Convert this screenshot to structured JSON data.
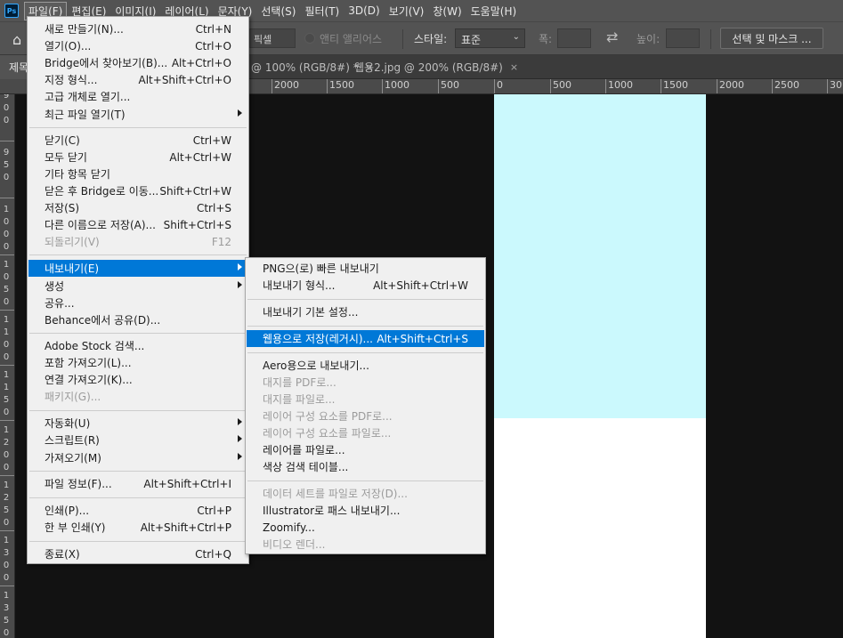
{
  "menubar": {
    "logo": "Ps",
    "items": [
      {
        "label": "파일(F)",
        "active": true
      },
      {
        "label": "편집(E)"
      },
      {
        "label": "이미지(I)"
      },
      {
        "label": "레이어(L)"
      },
      {
        "label": "문자(Y)"
      },
      {
        "label": "선택(S)"
      },
      {
        "label": "필터(T)"
      },
      {
        "label": "3D(D)"
      },
      {
        "label": "보기(V)"
      },
      {
        "label": "창(W)"
      },
      {
        "label": "도움말(H)"
      }
    ]
  },
  "options": {
    "feather_value": "픽셀",
    "antialias_label": "앤티 앨리어스",
    "style_label": "스타일:",
    "style_value": "표준",
    "width_label": "폭:",
    "height_label": "높이:",
    "select_mask_label": "선택 및 마스크 ..."
  },
  "tabs": [
    {
      "title": "제목"
    },
    {
      "title": "@ 100% (RGB/8#) *",
      "close": "×"
    },
    {
      "title": "웹용2.jpg @ 200% (RGB/8#)",
      "close": "×"
    }
  ],
  "ruler": {
    "horizontal": [
      "2000",
      "1500",
      "1000",
      "500",
      "0",
      "500",
      "1000",
      "1500",
      "2000",
      "2500",
      "30"
    ],
    "vertical": [
      "9",
      "0",
      "0",
      "9",
      "5",
      "0",
      "1",
      "0",
      "0",
      "0",
      "1",
      "0",
      "5",
      "0",
      "1",
      "1",
      "0",
      "0",
      "1",
      "1",
      "5",
      "0",
      "1",
      "2",
      "0",
      "0",
      "1",
      "2",
      "5",
      "0",
      "1",
      "3",
      "0",
      "0",
      "1",
      "3",
      "5",
      "0"
    ]
  },
  "file_menu": {
    "items": [
      {
        "label": "새로 만들기(N)...",
        "shortcut": "Ctrl+N"
      },
      {
        "label": "열기(O)...",
        "shortcut": "Ctrl+O"
      },
      {
        "label": "Bridge에서 찾아보기(B)...",
        "shortcut": "Alt+Ctrl+O"
      },
      {
        "label": "지정 형식...",
        "shortcut": "Alt+Shift+Ctrl+O"
      },
      {
        "label": "고급 개체로 열기..."
      },
      {
        "label": "최근 파일 열기(T)",
        "submenu": true
      },
      {
        "label": "닫기(C)",
        "shortcut": "Ctrl+W"
      },
      {
        "label": "모두 닫기",
        "shortcut": "Alt+Ctrl+W"
      },
      {
        "label": "기타 항목 닫기"
      },
      {
        "label": "닫은 후 Bridge로 이동...",
        "shortcut": "Shift+Ctrl+W"
      },
      {
        "label": "저장(S)",
        "shortcut": "Ctrl+S"
      },
      {
        "label": "다른 이름으로 저장(A)...",
        "shortcut": "Shift+Ctrl+S"
      },
      {
        "label": "되돌리기(V)",
        "shortcut": "F12",
        "disabled": true
      },
      {
        "label": "내보내기(E)",
        "submenu": true,
        "highlighted": true
      },
      {
        "label": "생성",
        "submenu": true
      },
      {
        "label": "공유..."
      },
      {
        "label": "Behance에서 공유(D)..."
      },
      {
        "label": "Adobe Stock 검색..."
      },
      {
        "label": "포함 가져오기(L)..."
      },
      {
        "label": "연결 가져오기(K)..."
      },
      {
        "label": "패키지(G)...",
        "disabled": true
      },
      {
        "label": "자동화(U)",
        "submenu": true
      },
      {
        "label": "스크립트(R)",
        "submenu": true
      },
      {
        "label": "가져오기(M)",
        "submenu": true
      },
      {
        "label": "파일 정보(F)...",
        "shortcut": "Alt+Shift+Ctrl+I"
      },
      {
        "label": "인쇄(P)...",
        "shortcut": "Ctrl+P"
      },
      {
        "label": "한 부 인쇄(Y)",
        "shortcut": "Alt+Shift+Ctrl+P"
      },
      {
        "label": "종료(X)",
        "shortcut": "Ctrl+Q"
      }
    ]
  },
  "export_submenu": {
    "items": [
      {
        "label": "PNG으(로) 빠른 내보내기"
      },
      {
        "label": "내보내기 형식...",
        "shortcut": "Alt+Shift+Ctrl+W"
      },
      {
        "label": "내보내기 기본 설정..."
      },
      {
        "label": "웹용으로 저장(레거시)...",
        "shortcut": "Alt+Shift+Ctrl+S",
        "highlighted": true
      },
      {
        "label": "Aero용으로 내보내기..."
      },
      {
        "label": "대지를 PDF로...",
        "disabled": true
      },
      {
        "label": "대지를 파일로...",
        "disabled": true
      },
      {
        "label": "레이어 구성 요소를 PDF로...",
        "disabled": true
      },
      {
        "label": "레이어 구성 요소를 파일로...",
        "disabled": true
      },
      {
        "label": "레이어를 파일로..."
      },
      {
        "label": "색상 검색 테이블..."
      },
      {
        "label": "데이터 세트를 파일로 저장(D)...",
        "disabled": true
      },
      {
        "label": "Illustrator로 패스 내보내기..."
      },
      {
        "label": "Zoomify..."
      },
      {
        "label": "비디오 렌더...",
        "disabled": true
      }
    ]
  },
  "colors": {
    "highlight": "#0078d7",
    "canvas_cyan": "#cbf9fd",
    "canvas_white": "#ffffff",
    "menu_bg": "#f0f0f0",
    "chrome_bg": "#535353"
  }
}
